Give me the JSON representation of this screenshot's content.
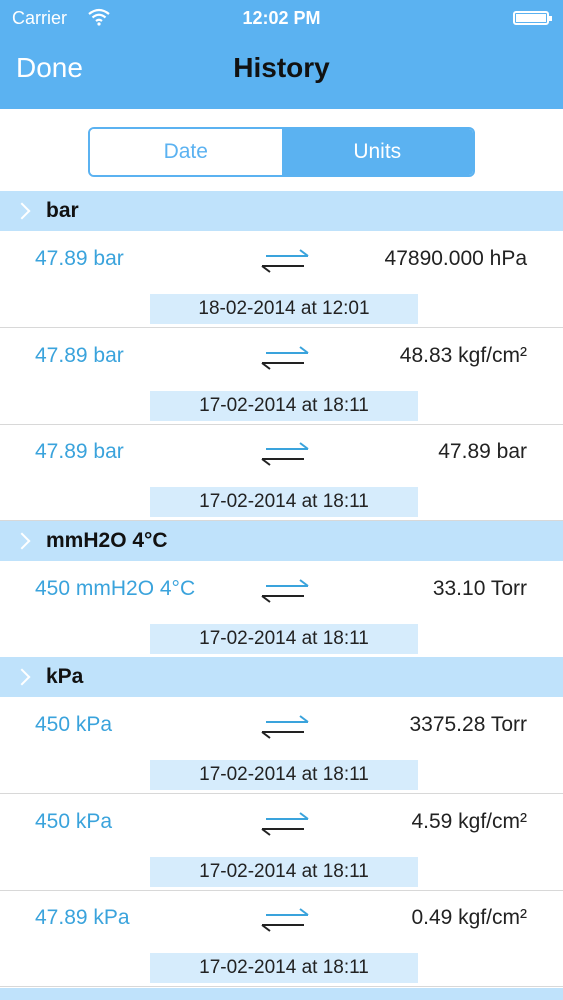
{
  "status_bar": {
    "carrier": "Carrier",
    "time": "12:02 PM"
  },
  "nav": {
    "done_label": "Done",
    "title": "History"
  },
  "segment": {
    "options": [
      "Date",
      "Units"
    ],
    "selected": "Units"
  },
  "sections": [
    {
      "title": "bar",
      "rows": [
        {
          "from": "47.89 bar",
          "to": "47890.000 hPa",
          "date": "18-02-2014 at 12:01"
        },
        {
          "from": "47.89 bar",
          "to": "48.83 kgf/cm²",
          "date": "17-02-2014 at 18:11"
        },
        {
          "from": "47.89 bar",
          "to": "47.89 bar",
          "date": "17-02-2014 at 18:11"
        }
      ]
    },
    {
      "title": "mmH2O 4°C",
      "rows": [
        {
          "from": "450 mmH2O 4°C",
          "to": "33.10 Torr",
          "date": "17-02-2014 at 18:11"
        }
      ]
    },
    {
      "title": "kPa",
      "rows": [
        {
          "from": "450 kPa",
          "to": "3375.28 Torr",
          "date": "17-02-2014 at 18:11"
        },
        {
          "from": "450 kPa",
          "to": "4.59 kgf/cm²",
          "date": "17-02-2014 at 18:11"
        },
        {
          "from": "47.89 kPa",
          "to": "0.49 kgf/cm²",
          "date": "17-02-2014 at 18:11"
        }
      ]
    }
  ],
  "icons": {
    "swap": "swap-arrows-icon",
    "chevron": "chevron-right-icon",
    "wifi": "wifi-icon",
    "battery": "battery-icon"
  },
  "colors": {
    "accent": "#5bb2f1",
    "section_bg": "#bfe2fb",
    "date_bg": "#d6ecfc",
    "value_blue": "#3aa3dc"
  }
}
